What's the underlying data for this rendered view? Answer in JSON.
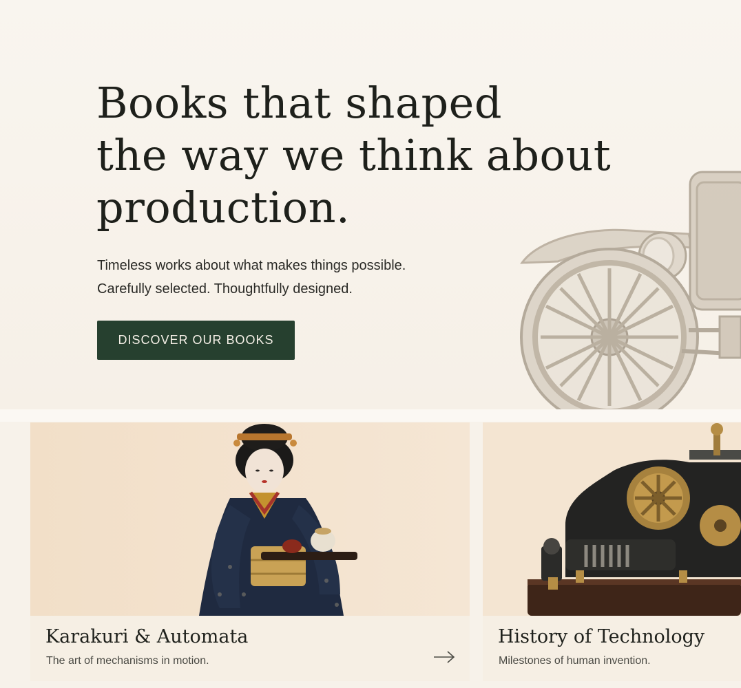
{
  "hero": {
    "title_lines": [
      "Books that shaped",
      "the way we think about",
      "production."
    ],
    "subtitle_lines": [
      "Timeless works about what makes things possible.",
      "Carefully selected. Thoughtfully designed."
    ],
    "cta_label": "DISCOVER OUR BOOKS",
    "image": "vintage-car-illustration"
  },
  "cards": [
    {
      "title": "Karakuri & Automata",
      "description": "The art of mechanisms in motion.",
      "image": "karakuri-doll-serving-tea",
      "icon": "arrow-right-icon"
    },
    {
      "title": "History of Technology",
      "description": "Milestones of human invention.",
      "image": "brass-machine-gears"
    }
  ],
  "colors": {
    "background": "#f7f2ea",
    "accent": "#26402f",
    "text": "#1e201b",
    "card_image_bg": "#f3e2cd"
  }
}
